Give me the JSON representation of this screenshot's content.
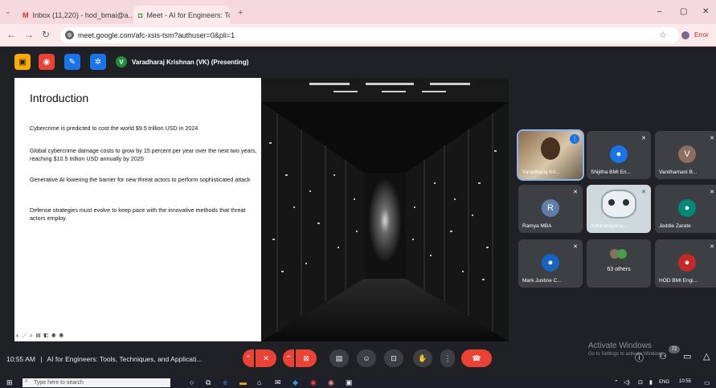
{
  "browser": {
    "tabs": [
      {
        "label": "Inbox (11,220) - hod_bmai@a..."
      },
      {
        "label": "Meet - AI for Engineers: To..."
      }
    ],
    "url": "meet.google.com/afc-xsis-tsm?authuser=0&pli=1",
    "error_label": "Error"
  },
  "meet": {
    "presenter": "Varadharaj Krishnan (VK) (Presenting)",
    "presenter_initial": "V",
    "time": "10:55 AM",
    "separator": "|",
    "title": "AI for Engineers: Tools, Techniques, and Applicati...",
    "accent": "#1a73e8",
    "end_call_color": "#ea4335"
  },
  "slide": {
    "title": "Introduction",
    "bullets": [
      "Cybercrime is predicted to cost the world $9.5 trillion USD in 2024",
      "Global cybercrime damage costs to grow by 15 percent per year over the next two years, reaching $10.5 trillion USD annually by 2025",
      "Generative AI lowering the barrier for new threat actors to perform sophisticated attack",
      "Defense strategies must evolve to keep pace with the innovative methods that threat actors employ."
    ]
  },
  "participants": [
    {
      "name": "Varadharaj Kri...",
      "type": "video"
    },
    {
      "name": "Shijitha BMI En...",
      "type": "avatar",
      "color": "#1a73e8"
    },
    {
      "name": "Vanithamani B...",
      "type": "initial",
      "initial": "V",
      "color": "#8d6e63"
    },
    {
      "name": "Ramya MBA",
      "type": "initial",
      "initial": "R",
      "color": "#5f7fa8"
    },
    {
      "name": "Adhinarayana...",
      "type": "robot"
    },
    {
      "name": "Jeddie Zarate",
      "type": "avatar",
      "color": "#00897b"
    },
    {
      "name": "Mark Justine C...",
      "type": "avatar",
      "color": "#1565c0"
    },
    {
      "name": "63 others",
      "type": "others"
    },
    {
      "name": "HOD BMI Engi...",
      "type": "avatar",
      "color": "#c62828"
    }
  ],
  "watermark": {
    "line1": "Activate Windows",
    "line2": "Go to Settings to activate Windows."
  },
  "chat_badge": "72",
  "taskbar": {
    "search_placeholder": "Type here to search",
    "clock_time": "10:55",
    "lang": "ENG"
  }
}
